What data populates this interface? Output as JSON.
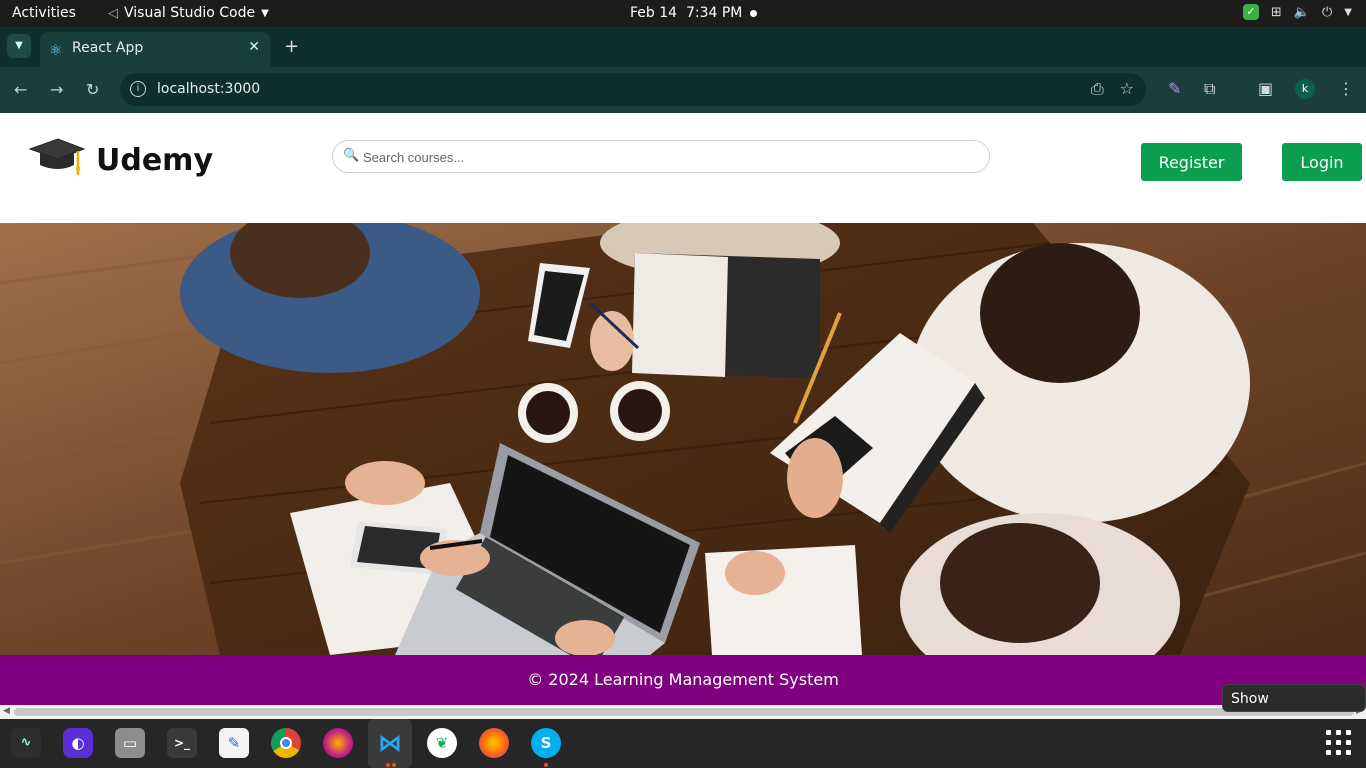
{
  "system": {
    "activities": "Activities",
    "app_menu": "Visual Studio Code",
    "date": "Feb 14",
    "time": "7:34 PM"
  },
  "browser": {
    "tab_title": "React App",
    "url": "localhost:3000",
    "profile_initial": "k"
  },
  "site": {
    "brand": "Udemy",
    "search_placeholder": "Search courses...",
    "register_label": "Register",
    "login_label": "Login",
    "footer_text": "© 2024 Learning Management System",
    "accent": "#0b9e4f",
    "footer_color": "#800080"
  },
  "tooltip": "Show Applications",
  "dock": {
    "items": [
      "system-monitor-icon",
      "screenshot-icon",
      "files-icon",
      "terminal-icon",
      "text-editor-icon",
      "chrome-icon",
      "firefox-dev-icon",
      "vscode-icon",
      "mongodb-compass-icon",
      "firefox-icon",
      "skype-icon"
    ]
  }
}
